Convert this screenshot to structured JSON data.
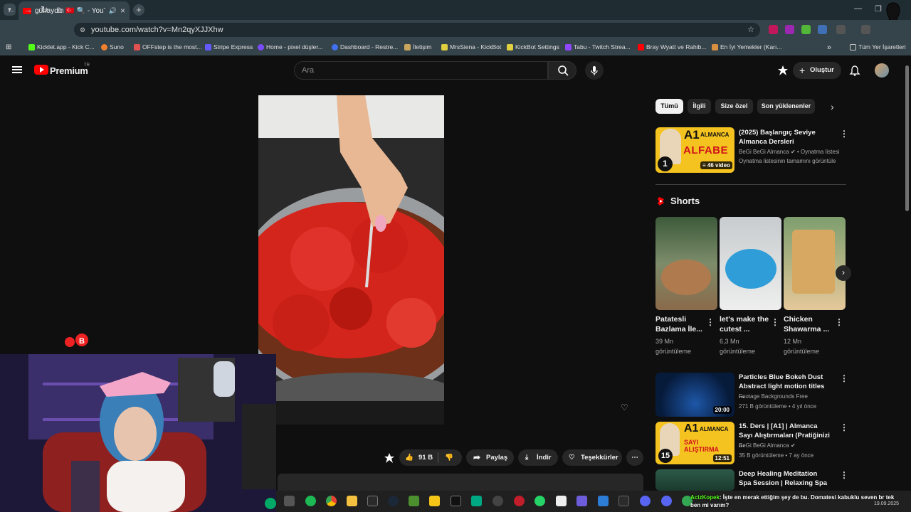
{
  "browser": {
    "tab_title": "günaydin 🇹🇷 🔍 - YouTube",
    "url": "youtube.com/watch?v=Mn2qyXJJXhw",
    "bookmarks": [
      "Kicklet.app - Kick C...",
      "Suno",
      "OFFstep is the most...",
      "Stripe Express",
      "Home - pixel düşler...",
      "Dashboard - Restre...",
      "İletişim",
      "MrsSiena - KickBot",
      "KickBot Settings",
      "Tabu - Twitch Strea...",
      "Bray Wyatt ve Rahib...",
      "En İyi Yemekler (Karı..."
    ],
    "all_bookmarks": "Tüm Yer İşaretleri"
  },
  "youtube": {
    "logo": "Premium",
    "logo_sup": "TR",
    "search_placeholder": "Ara",
    "create_label": "Oluştur",
    "actions": {
      "likes": "91 B",
      "share": "Paylaş",
      "download": "İndir",
      "thanks": "Teşekkürler"
    },
    "chips": [
      "Tümü",
      "İlgili",
      "Size özel",
      "Son yüklenenler"
    ],
    "playlist": {
      "title": "(2025) Başlangıç Seviye Almanca Dersleri",
      "channel": "BeGi BeGi Almanca",
      "type": "Oynatma listesi",
      "link": "Oynatma listesinin tamamını görüntüle",
      "count": "46 video",
      "thumb_top": "A1",
      "thumb_mid": "ALMANCA",
      "thumb_bottom": "ALFABE",
      "thumb_num": "1"
    },
    "shorts_heading": "Shorts",
    "shorts": [
      {
        "title": "Patatesli Bazlama İle...",
        "views": "39 Mn",
        "views_label": "görüntüleme"
      },
      {
        "title": "let's make the cutest ...",
        "views": "6,3 Mn",
        "views_label": "görüntüleme"
      },
      {
        "title": "Chicken Shawarma ...",
        "views": "12 Mn",
        "views_label": "görüntüleme"
      }
    ],
    "videos": [
      {
        "title": "Particles Blue Bokeh Dust Abstract light motion titles ...",
        "channel": "Footage Backgrounds Free",
        "meta": "271 B görüntüleme • 4 yıl önce",
        "duration": "20:00"
      },
      {
        "title": "15. Ders | [A1] | Almanca Sayı Alıştırmaları (Pratiğinizi ...",
        "channel": "BeGi BeGi Almanca",
        "meta": "35 B görüntüleme • 7 ay önce",
        "duration": "12:51",
        "thumb_top": "A1",
        "thumb_mid": "ALMANCA",
        "thumb_bottom": "SAYI ALIŞTIRMA",
        "thumb_num": "15"
      },
      {
        "title": "Deep Healing Meditation Spa Session | Relaxing Spa ..."
      }
    ]
  },
  "overlay": {
    "chat_user": "AcizKopek",
    "chat_text": ": İşte en merak ettiğim şey de bu. Domatesi kabuklu seven br tek ben mi varım?",
    "date": "19.09.2025"
  }
}
